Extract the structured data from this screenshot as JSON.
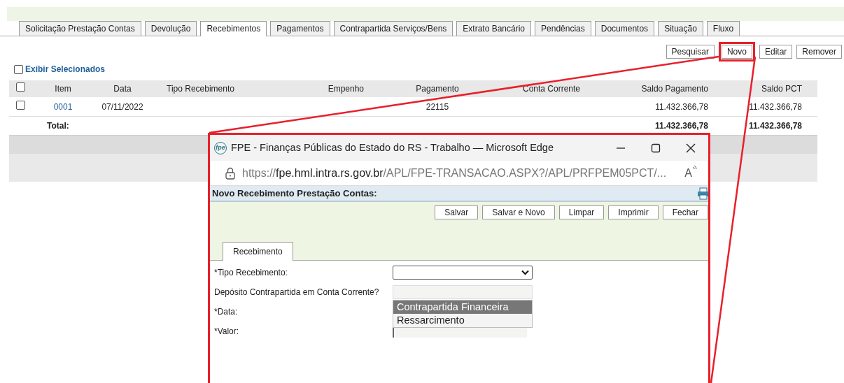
{
  "tabs": [
    {
      "label": "Solicitação Prestação Contas",
      "selected": false
    },
    {
      "label": "Devolução",
      "selected": false
    },
    {
      "label": "Recebimentos",
      "selected": true
    },
    {
      "label": "Pagamentos",
      "selected": false
    },
    {
      "label": "Contrapartida Serviços/Bens",
      "selected": false
    },
    {
      "label": "Extrato Bancário",
      "selected": false
    },
    {
      "label": "Pendências",
      "selected": false
    },
    {
      "label": "Documentos",
      "selected": false
    },
    {
      "label": "Situação",
      "selected": false
    },
    {
      "label": "Fluxo",
      "selected": false
    }
  ],
  "toolbar": [
    {
      "label": "Pesquisar",
      "highlighted": false
    },
    {
      "label": "Novo",
      "highlighted": true
    },
    {
      "label": "Editar",
      "highlighted": false
    },
    {
      "label": "Remover",
      "highlighted": false
    }
  ],
  "filter": {
    "label": "Exibir Selecionados",
    "checked": false
  },
  "table": {
    "header_checked": false,
    "columns": [
      "Item",
      "Data",
      "Tipo Recebimento",
      "Empenho",
      "Pagamento",
      "Conta Corrente",
      "Saldo Pagamento",
      "Saldo PCT"
    ],
    "rows": [
      {
        "selected": false,
        "cells": [
          "0001",
          "07/11/2022",
          "",
          "",
          "22115",
          "",
          "11.432.366,78",
          "11.432.366,78"
        ]
      }
    ],
    "total": {
      "label": "Total:",
      "saldo_pagamento": "11.432.366,78",
      "saldo_pct": "11.432.366,78"
    }
  },
  "popup": {
    "logo": "fpe",
    "title": "FPE - Finanças Públicas do Estado do RS - Trabalho — Microsoft Edge",
    "url": {
      "scheme": "https://",
      "host": "fpe.hml.intra.rs.gov.br",
      "path": "/APL/FPE-TRANSACAO.ASPX?/APL/PRFPEM05PCT/..."
    },
    "read_aloud": "A",
    "heading": "Novo Recebimento Prestação Contas:",
    "buttons": [
      "Salvar",
      "Salvar e Novo",
      "Limpar",
      "Imprimir",
      "Fechar"
    ],
    "tabs": [
      {
        "label": "Recebimento",
        "selected": true
      }
    ],
    "fields": [
      {
        "label": "*Tipo Recebimento:",
        "kind": "select"
      },
      {
        "label": "Depósito Contrapartida em Conta Corrente?",
        "kind": "input"
      },
      {
        "label": "*Data:",
        "kind": "none"
      },
      {
        "label": "*Valor:",
        "kind": "input"
      }
    ],
    "dropdown": [
      {
        "label": "Contrapartida Financeira",
        "selected": true
      },
      {
        "label": "Ressarcimento",
        "selected": false
      }
    ]
  }
}
